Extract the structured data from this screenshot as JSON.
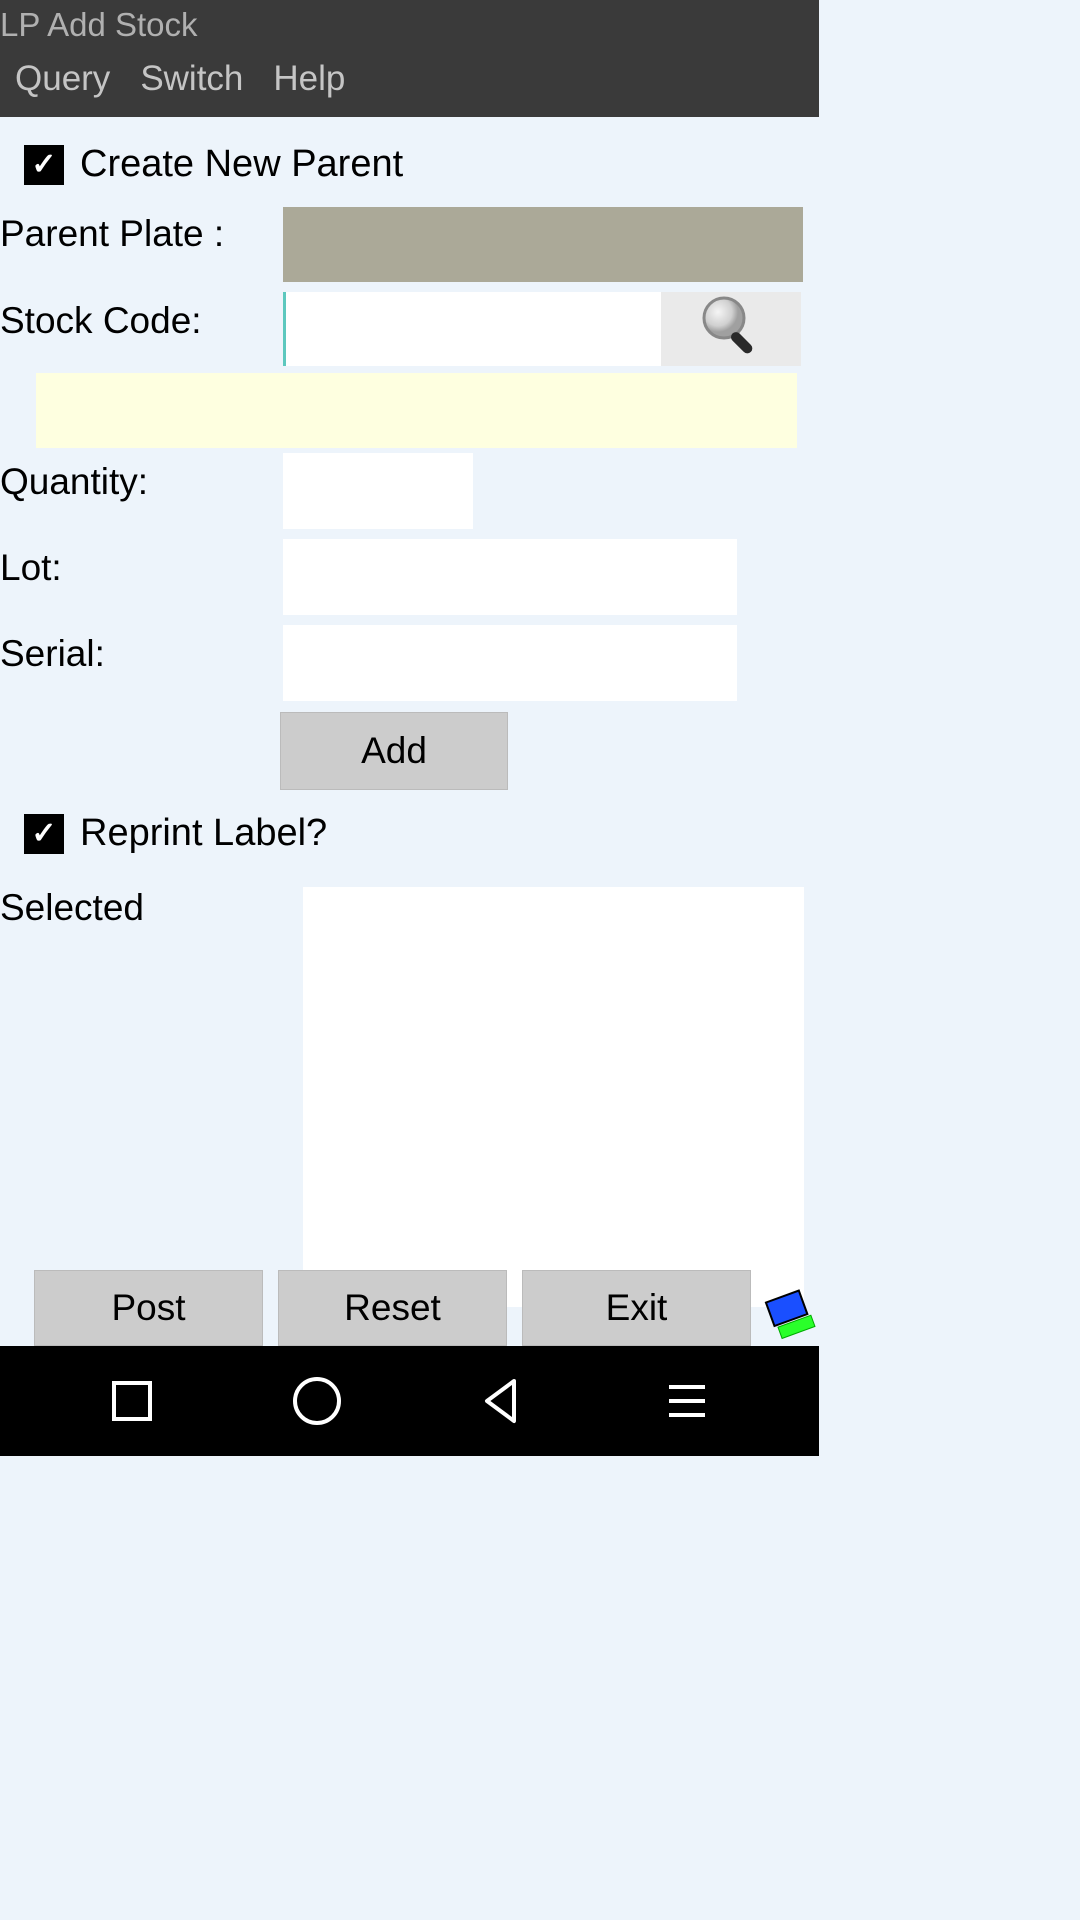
{
  "header": {
    "title": "LP Add Stock",
    "menu": {
      "query": "Query",
      "switch": "Switch",
      "help": "Help"
    }
  },
  "form": {
    "create_parent_label": "Create New Parent",
    "create_parent_checked": true,
    "parent_plate_label": "Parent Plate :",
    "parent_plate_value": "",
    "stock_code_label": "Stock Code:",
    "stock_code_value": "",
    "quantity_label": "Quantity:",
    "quantity_value": "",
    "lot_label": "Lot:",
    "lot_value": "",
    "serial_label": "Serial:",
    "serial_value": "",
    "add_button": "Add",
    "reprint_label": "Reprint Label?",
    "reprint_checked": true,
    "selected_label": "Selected",
    "selected_value": ""
  },
  "actions": {
    "post": "Post",
    "reset": "Reset",
    "exit": "Exit"
  },
  "icons": {
    "search": "search-icon",
    "checkmark": "✓"
  }
}
